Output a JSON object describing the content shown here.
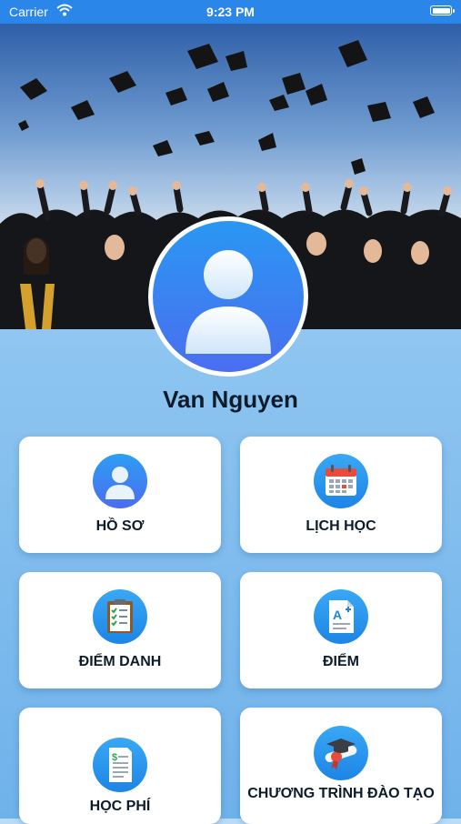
{
  "status_bar": {
    "carrier": "Carrier",
    "time": "9:23 PM"
  },
  "profile": {
    "name": "Van Nguyen"
  },
  "menu": {
    "items": [
      {
        "label": "HỒ SƠ",
        "icon": "profile-icon"
      },
      {
        "label": "LỊCH HỌC",
        "icon": "calendar-icon"
      },
      {
        "label": "ĐIỂM DANH",
        "icon": "clipboard-checklist-icon"
      },
      {
        "label": "ĐIỂM",
        "icon": "grade-document-icon"
      },
      {
        "label": "HỌC PHÍ",
        "icon": "tuition-document-icon"
      },
      {
        "label": "CHƯƠNG TRÌNH ĐÀO TẠO",
        "icon": "diploma-icon"
      }
    ]
  },
  "colors": {
    "status_bar": "#2a86e8",
    "icon_blue": "#1d85e6",
    "background": "#8cc4f0"
  }
}
